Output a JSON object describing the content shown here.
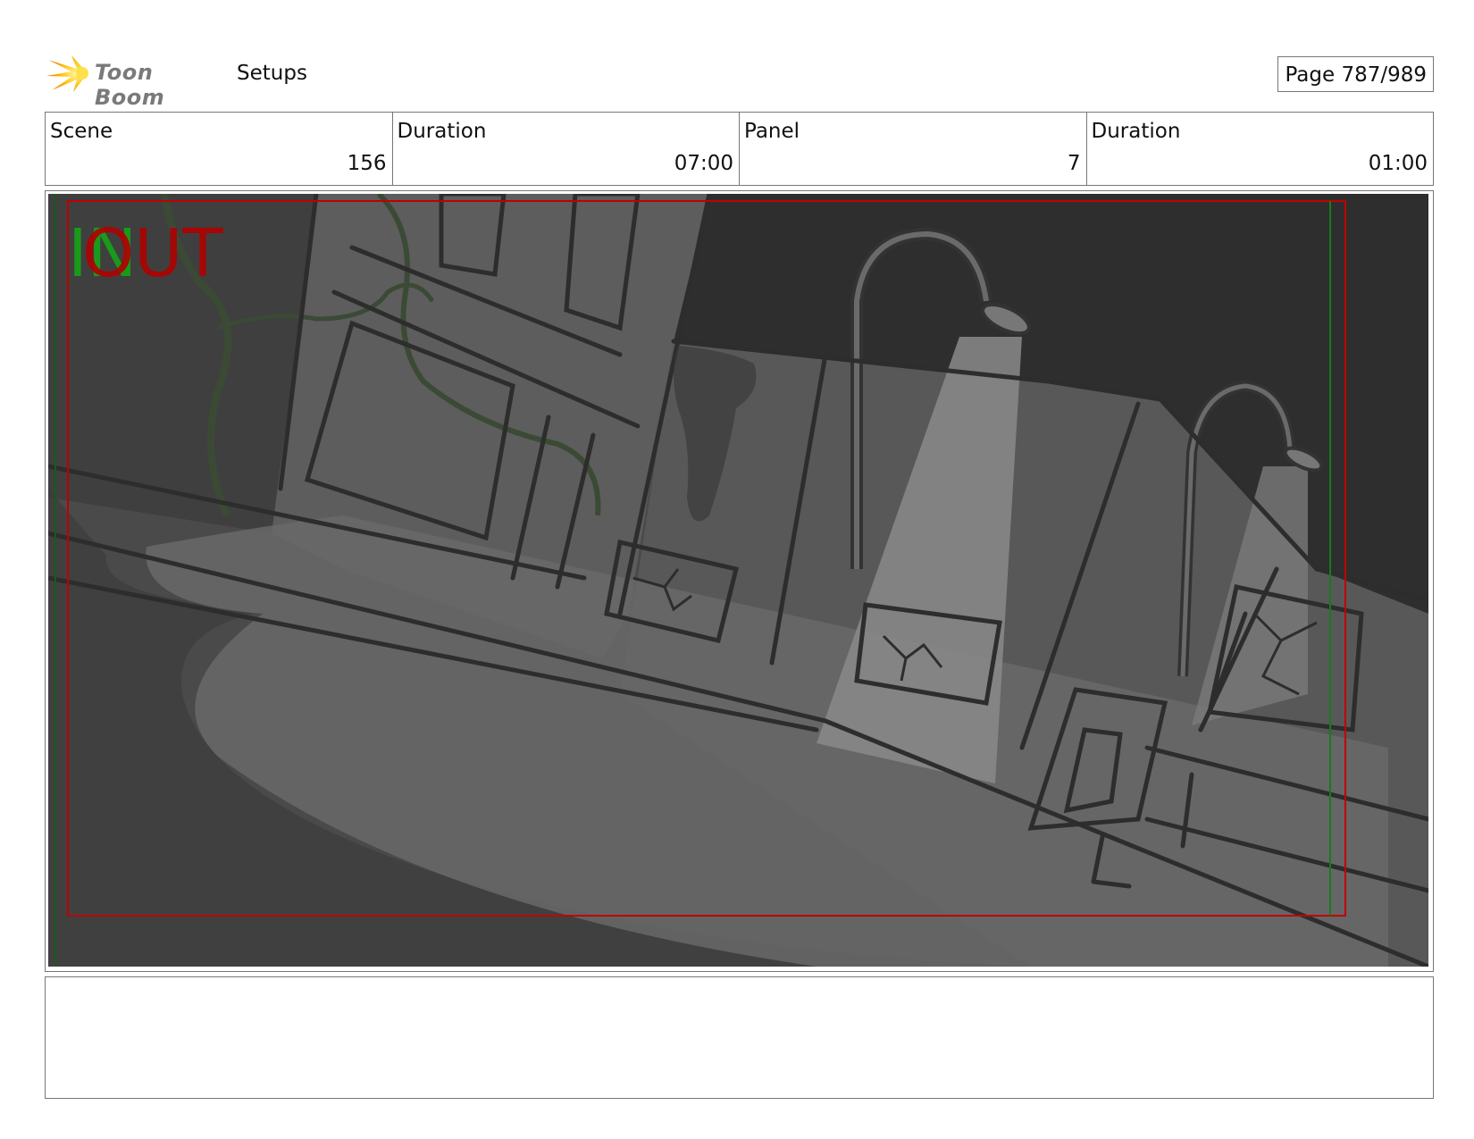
{
  "header": {
    "logo_text": "Toon Boom",
    "section_title": "Setups",
    "page_label": "Page 787/989"
  },
  "info": {
    "scene_label": "Scene",
    "scene_value": "156",
    "scene_duration_label": "Duration",
    "scene_duration_value": "07:00",
    "panel_label": "Panel",
    "panel_value": "7",
    "panel_duration_label": "Duration",
    "panel_duration_value": "01:00"
  },
  "panel": {
    "in_label": "IN",
    "out_label": "OUT"
  },
  "colors": {
    "in_marker": "#1a9a1a",
    "out_marker": "#b00000",
    "safe_frame_red": "#c00000",
    "safe_frame_green": "#1a7a1a"
  },
  "notes": {
    "text": ""
  }
}
